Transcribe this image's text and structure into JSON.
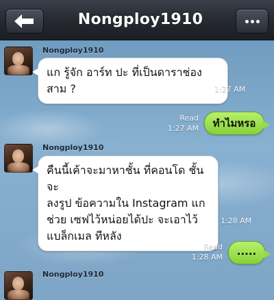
{
  "header": {
    "title": "Nongploy1910",
    "back_icon": "back-arrow-icon",
    "more_icon": "more-dots-icon"
  },
  "messages": [
    {
      "direction": "in",
      "sender": "Nongploy1910",
      "text": "แก รู้จัก อาร์ท ปะ ที่เป็นดาราช่อง\nสาม ?",
      "time": "1:27 AM"
    },
    {
      "direction": "out",
      "text": "ทำไมหรอ",
      "status": "Read",
      "time": "1:27 AM"
    },
    {
      "direction": "in",
      "sender": "Nongploy1910",
      "text": "คืนนี้เค้าจะมาหาชั้น ที่คอนโด ชั้นจะ\nลงรูป ข้อความใน Instagram แก\nช่วย เซฟไว้หน่อยได้ปะ จะเอาไว้\nแบล็กเมล ทีหลัง",
      "time": "1:28 AM"
    },
    {
      "direction": "out",
      "text": ".....",
      "status": "Read",
      "time": "1:28 AM"
    },
    {
      "direction": "in",
      "sender": "Nongploy1910"
    }
  ],
  "colors": {
    "navbar": "#262a31",
    "outgoing_bubble": "#86d23a",
    "incoming_bubble": "#ffffff",
    "chat_background": "#7fa6c7"
  }
}
